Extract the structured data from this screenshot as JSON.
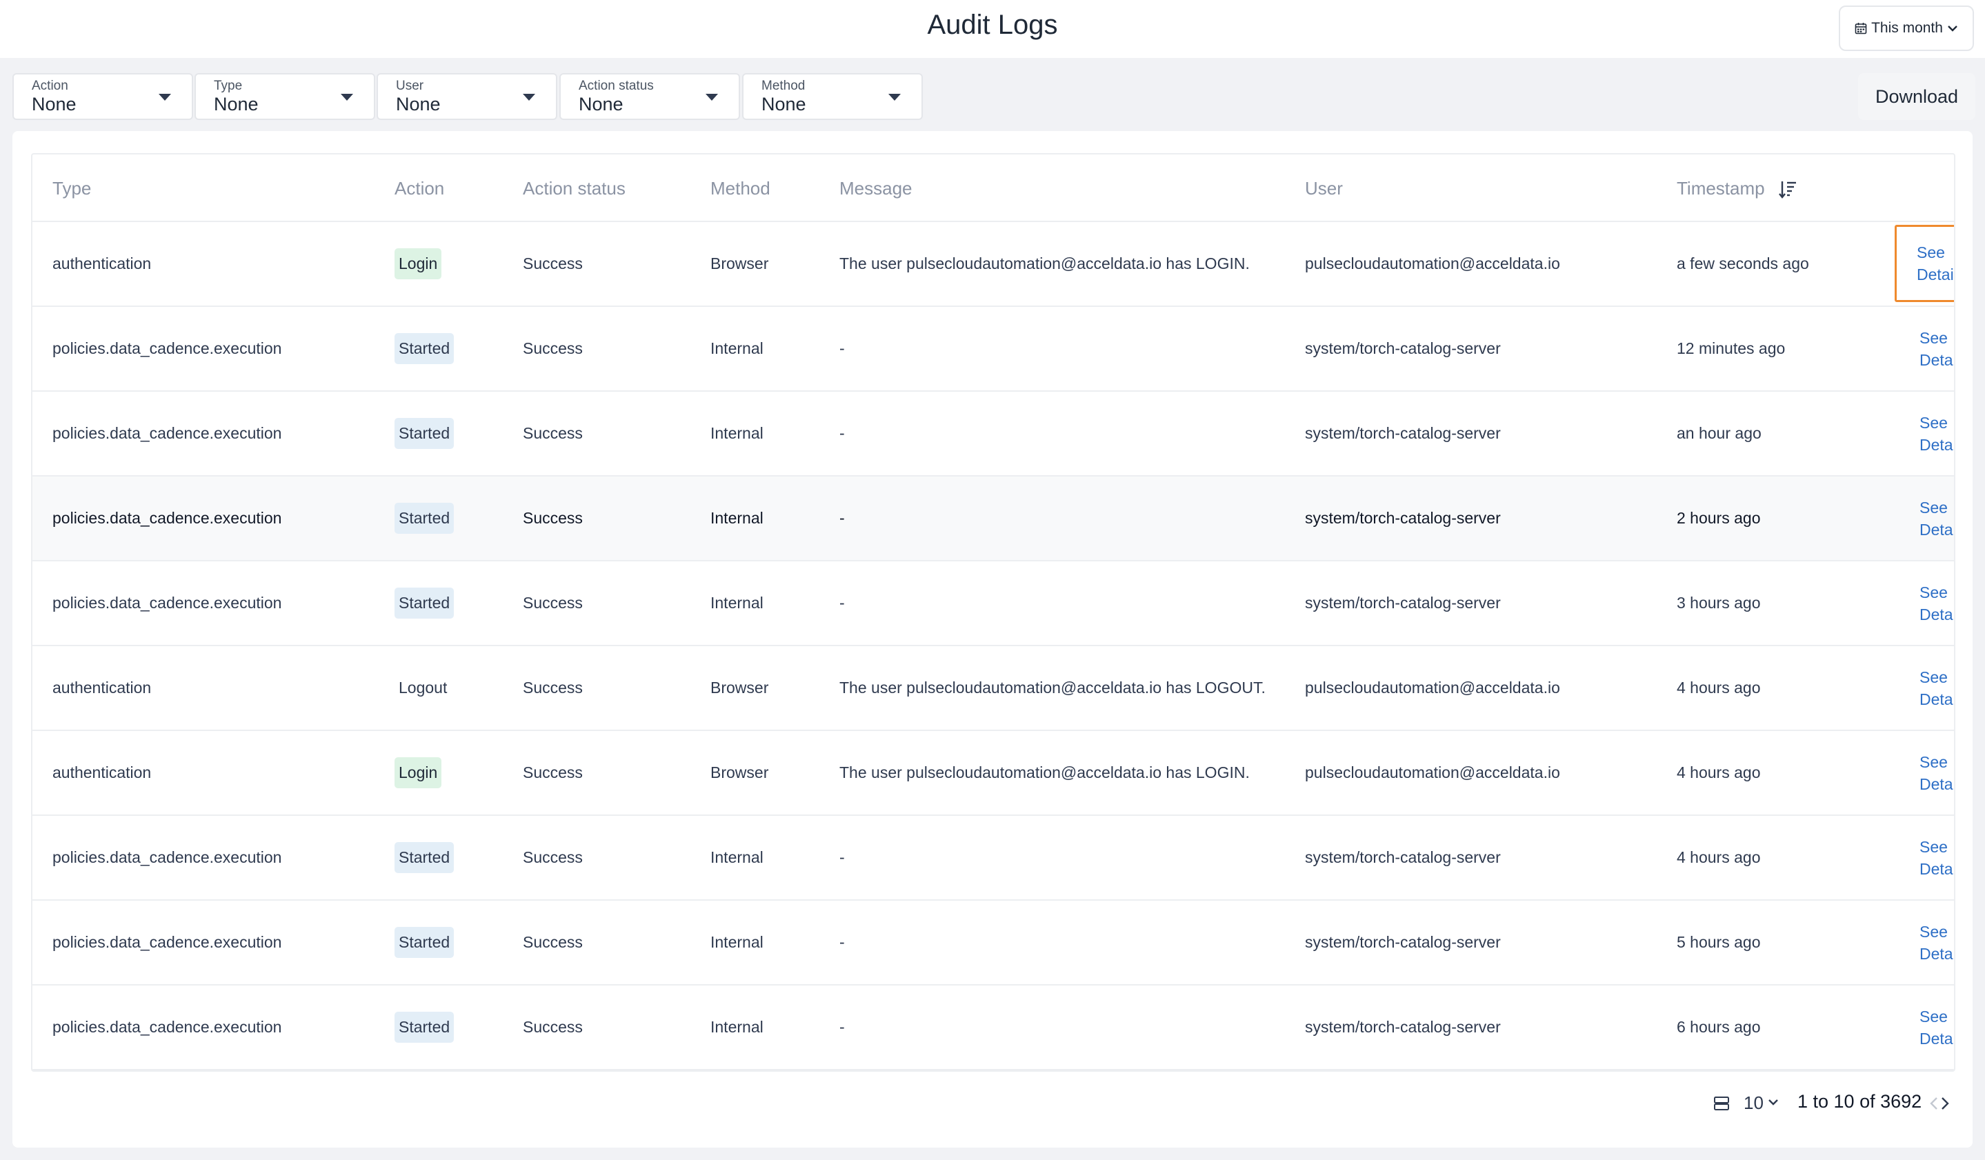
{
  "header": {
    "title": "Audit Logs",
    "date_range": "This month"
  },
  "filters": [
    {
      "label": "Action",
      "value": "None"
    },
    {
      "label": "Type",
      "value": "None"
    },
    {
      "label": "User",
      "value": "None"
    },
    {
      "label": "Action status",
      "value": "None"
    },
    {
      "label": "Method",
      "value": "None"
    }
  ],
  "download_label": "Download",
  "table": {
    "columns": [
      "Type",
      "Action",
      "Action status",
      "Method",
      "Message",
      "User",
      "Timestamp"
    ],
    "details_label_1": "See",
    "details_label_2": "Details",
    "rows": [
      {
        "type": "authentication",
        "action": "Login",
        "status": "Success",
        "method": "Browser",
        "message": "The user pulsecloudautomation@acceldata.io has LOGIN.",
        "user": "pulsecloudautomation@acceldata.io",
        "timestamp": "a few seconds ago"
      },
      {
        "type": "policies.data_cadence.execution",
        "action": "Started",
        "status": "Success",
        "method": "Internal",
        "message": "-",
        "user": "system/torch-catalog-server",
        "timestamp": "12 minutes ago"
      },
      {
        "type": "policies.data_cadence.execution",
        "action": "Started",
        "status": "Success",
        "method": "Internal",
        "message": "-",
        "user": "system/torch-catalog-server",
        "timestamp": "an hour ago"
      },
      {
        "type": "policies.data_cadence.execution",
        "action": "Started",
        "status": "Success",
        "method": "Internal",
        "message": "-",
        "user": "system/torch-catalog-server",
        "timestamp": "2 hours ago"
      },
      {
        "type": "policies.data_cadence.execution",
        "action": "Started",
        "status": "Success",
        "method": "Internal",
        "message": "-",
        "user": "system/torch-catalog-server",
        "timestamp": "3 hours ago"
      },
      {
        "type": "authentication",
        "action": "Logout",
        "status": "Success",
        "method": "Browser",
        "message": "The user pulsecloudautomation@acceldata.io has LOGOUT.",
        "user": "pulsecloudautomation@acceldata.io",
        "timestamp": "4 hours ago"
      },
      {
        "type": "authentication",
        "action": "Login",
        "status": "Success",
        "method": "Browser",
        "message": "The user pulsecloudautomation@acceldata.io has LOGIN.",
        "user": "pulsecloudautomation@acceldata.io",
        "timestamp": "4 hours ago"
      },
      {
        "type": "policies.data_cadence.execution",
        "action": "Started",
        "status": "Success",
        "method": "Internal",
        "message": "-",
        "user": "system/torch-catalog-server",
        "timestamp": "4 hours ago"
      },
      {
        "type": "policies.data_cadence.execution",
        "action": "Started",
        "status": "Success",
        "method": "Internal",
        "message": "-",
        "user": "system/torch-catalog-server",
        "timestamp": "5 hours ago"
      },
      {
        "type": "policies.data_cadence.execution",
        "action": "Started",
        "status": "Success",
        "method": "Internal",
        "message": "-",
        "user": "system/torch-catalog-server",
        "timestamp": "6 hours ago"
      }
    ]
  },
  "pagination": {
    "page_size": "10",
    "range_text": "1 to 10 of 3692"
  },
  "icons": {
    "calendar": "calendar-icon",
    "sort": "sort-descending-icon",
    "rows": "rows-per-page-icon",
    "prev": "chevron-left-icon",
    "next": "chevron-right-icon"
  },
  "colors": {
    "link": "#2e6fc6",
    "focus_outline": "#ef8a2e",
    "login_badge": "#ddf3e4",
    "started_badge": "#e3eef7"
  }
}
